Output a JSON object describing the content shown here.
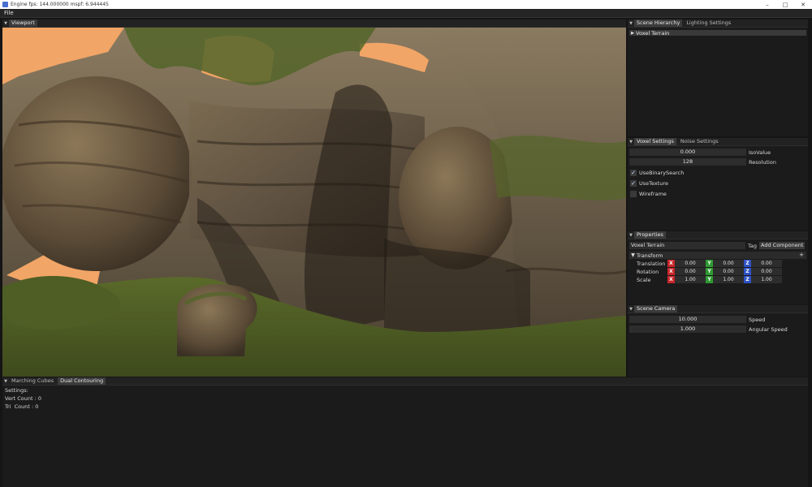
{
  "window": {
    "title": "Engine fps: 144.000000   mspf: 6.944445"
  },
  "menu": {
    "file": "File"
  },
  "viewport": {
    "tab": "Viewport"
  },
  "hierarchy": {
    "tabs": [
      "Scene Hierarchy",
      "Lighting Settings"
    ],
    "items": [
      "Voxel Terrain"
    ]
  },
  "voxel_settings": {
    "tabs": [
      "Voxel Settings",
      "Noise Settings"
    ],
    "iso_value": "0.000",
    "iso_label": "IsoValue",
    "resolution": "128",
    "resolution_label": "Resolution",
    "checks": [
      {
        "label": "UseBinarySearch",
        "checked": true
      },
      {
        "label": "UseTexture",
        "checked": true
      },
      {
        "label": "Wireframe",
        "checked": false
      }
    ]
  },
  "properties": {
    "tab": "Properties",
    "name": "Voxel Terrain",
    "tag_label": "Tag",
    "add_component": "Add Component",
    "transform_label": "Transform",
    "rows": [
      {
        "label": "Translation",
        "x": "0.00",
        "y": "0.00",
        "z": "0.00"
      },
      {
        "label": "Rotation",
        "x": "0.00",
        "y": "0.00",
        "z": "0.00"
      },
      {
        "label": "Scale",
        "x": "1.00",
        "y": "1.00",
        "z": "1.00"
      }
    ]
  },
  "camera": {
    "tab": "Scene Camera",
    "speed": "10.000",
    "speed_label": "Speed",
    "angular_speed": "1.000",
    "angular_label": "Angular Speed"
  },
  "bottom": {
    "tabs": [
      "Marching Cubes",
      "Dual Contouring"
    ],
    "lines": [
      "Settings:",
      "Vert Count : 0",
      "Tri  Count : 0"
    ]
  },
  "colors": {
    "accent": "#3b3b3b",
    "axis_x": "#c8262a",
    "axis_y": "#2f9a33",
    "axis_z": "#2e52c4",
    "sky": "#f1a566"
  }
}
